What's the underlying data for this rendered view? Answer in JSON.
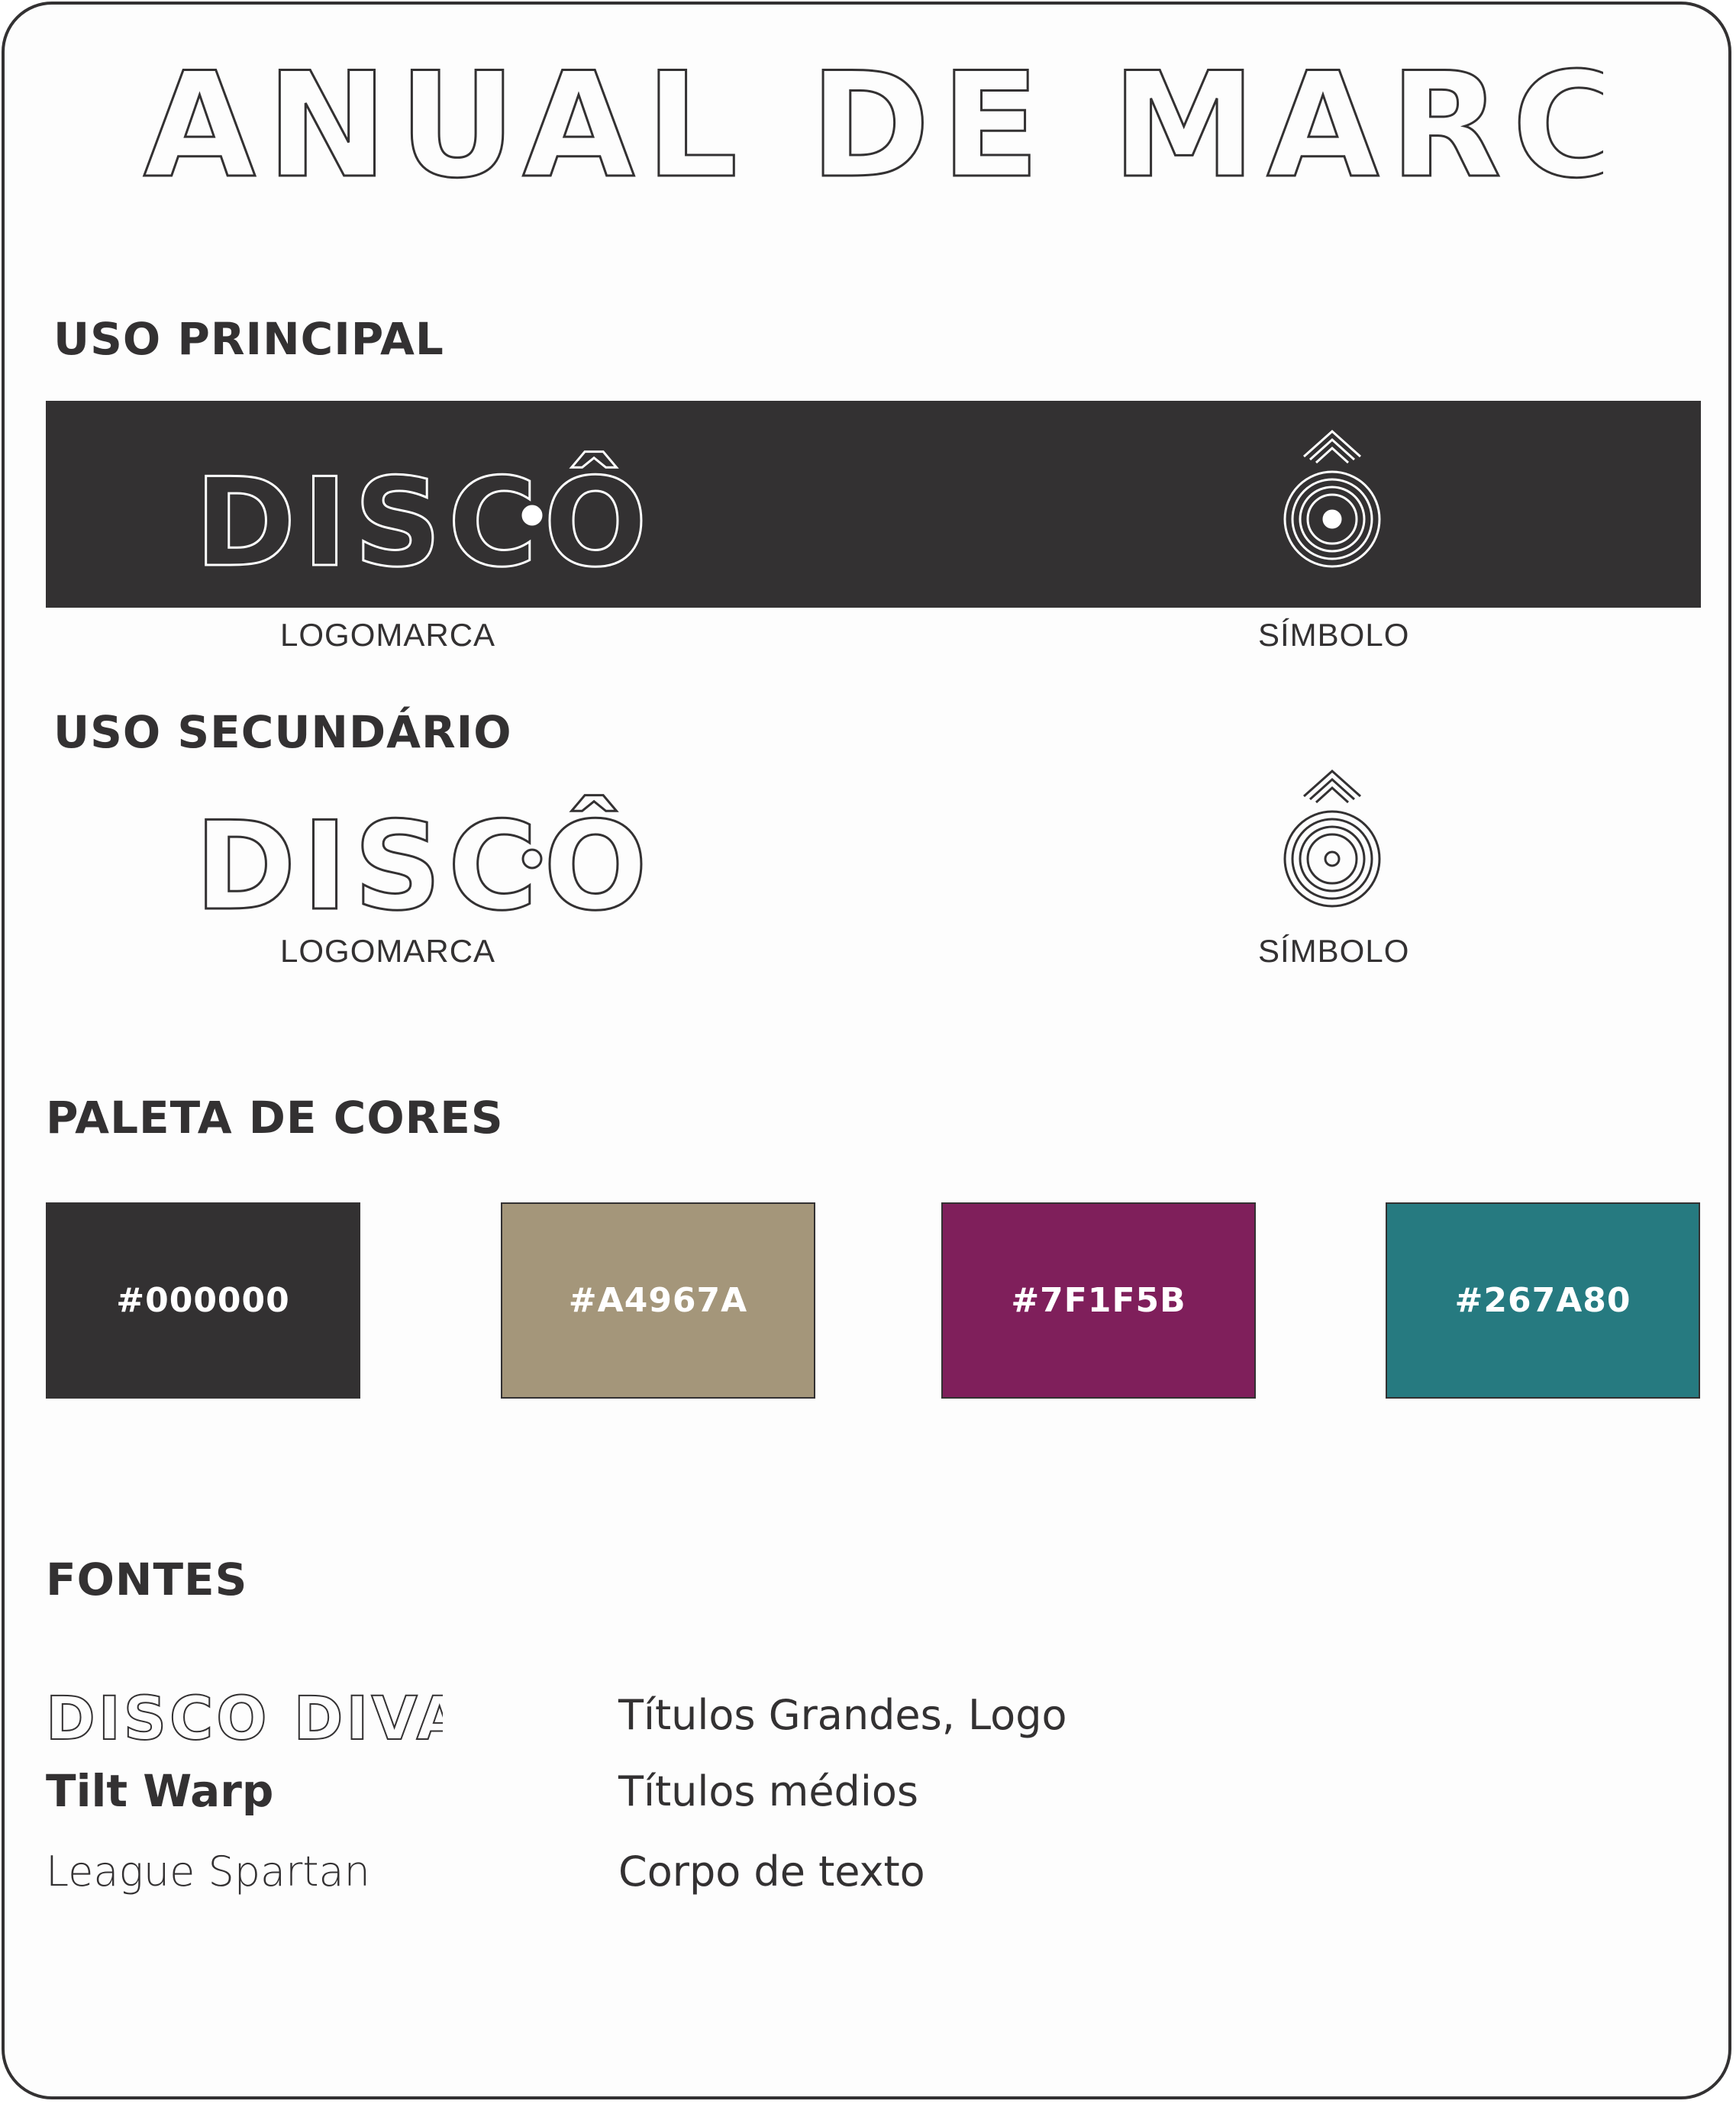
{
  "title": "MANUAL DE MARCA",
  "uso_principal": {
    "heading": "USO PRINCIPAL",
    "logo_text": "DISCÔ",
    "logo_caption": "LOGOMARCA",
    "symbol_caption": "SÍMBOLO"
  },
  "uso_secundario": {
    "heading": "USO SECUNDÁRIO",
    "logo_text": "DISCÔ",
    "logo_caption": "LOGOMARCA",
    "symbol_caption": "SÍMBOLO"
  },
  "paleta": {
    "heading": "PALETA DE CORES",
    "swatches": [
      {
        "label": "#000000",
        "color": "#333132"
      },
      {
        "label": "#A4967A",
        "color": "#A4967A"
      },
      {
        "label": "#7F1F5B",
        "color": "#7F1F5B"
      },
      {
        "label": "#267A80",
        "color": "#267A80"
      }
    ]
  },
  "fontes": {
    "heading": "FONTES",
    "items": [
      {
        "name": "DISCO DIVA",
        "use": "Títulos Grandes, Logo"
      },
      {
        "name": "Tilt Warp",
        "use": "Títulos médios"
      },
      {
        "name": "League Spartan",
        "use": "Corpo de texto"
      }
    ]
  },
  "colors": {
    "dark": "#333132",
    "light": "#ffffff"
  }
}
